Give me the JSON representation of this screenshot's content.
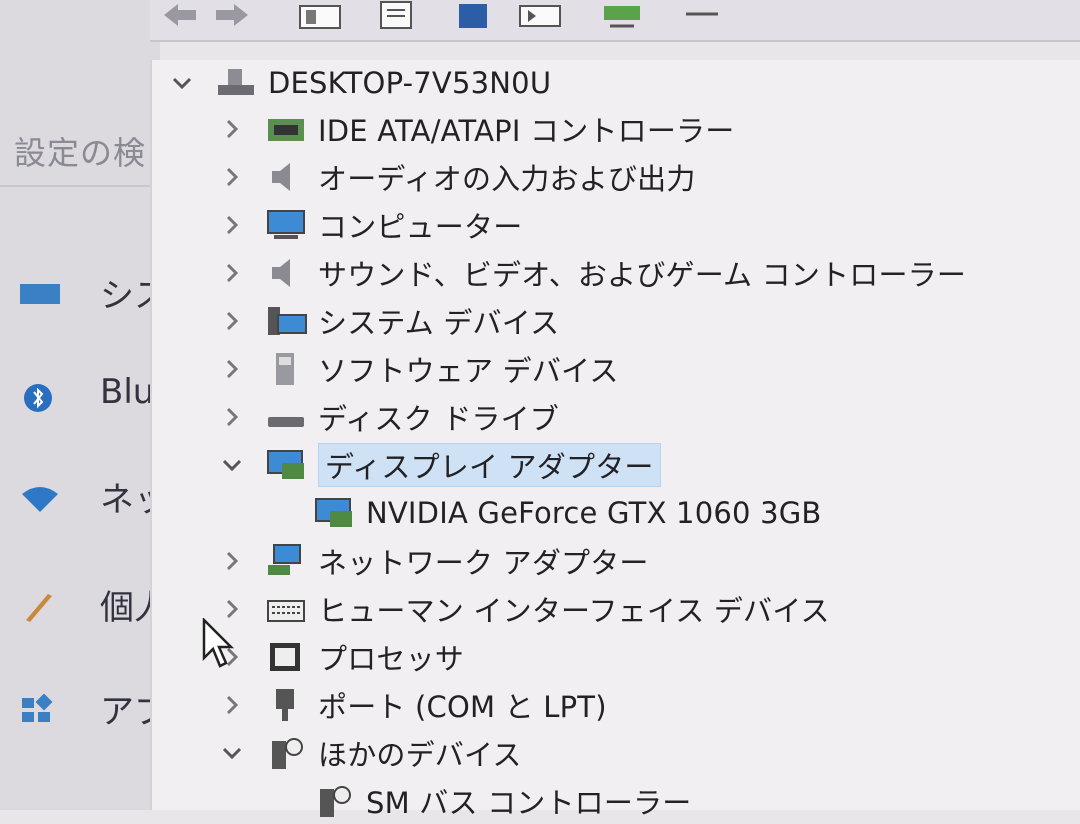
{
  "settings": {
    "search_label": "設定の検",
    "items": [
      {
        "label": "シス",
        "icon": "display-icon"
      },
      {
        "label": "Blu",
        "icon": "bluetooth-icon"
      },
      {
        "label": "ネッ",
        "icon": "wifi-icon"
      },
      {
        "label": "個人",
        "icon": "brush-icon"
      },
      {
        "label": "アプ",
        "icon": "apps-icon"
      }
    ]
  },
  "toolbar": {
    "buttons": [
      "back-icon",
      "forward-icon",
      "properties-icon",
      "update-driver-icon",
      "help-icon",
      "scan-icon",
      "monitor-icon",
      "remove-icon"
    ]
  },
  "tree": {
    "root": "DESKTOP-7V53N0U",
    "categories": [
      {
        "label": "IDE ATA/ATAPI コントローラー",
        "icon": "ide-controller-icon",
        "expanded": false
      },
      {
        "label": "オーディオの入力および出力",
        "icon": "speaker-icon",
        "expanded": false
      },
      {
        "label": "コンピューター",
        "icon": "computer-icon",
        "expanded": false
      },
      {
        "label": "サウンド、ビデオ、およびゲーム コントローラー",
        "icon": "speaker-icon",
        "expanded": false
      },
      {
        "label": "システム デバイス",
        "icon": "system-device-icon",
        "expanded": false
      },
      {
        "label": "ソフトウェア デバイス",
        "icon": "software-device-icon",
        "expanded": false
      },
      {
        "label": "ディスク ドライブ",
        "icon": "disk-drive-icon",
        "expanded": false
      },
      {
        "label": "ディスプレイ アダプター",
        "icon": "display-adapter-icon",
        "expanded": true,
        "selected": true
      },
      {
        "label": "NVIDIA GeForce GTX 1060 3GB",
        "icon": "display-adapter-icon",
        "child": true
      },
      {
        "label": "ネットワーク アダプター",
        "icon": "network-adapter-icon",
        "expanded": false
      },
      {
        "label": "ヒューマン インターフェイス デバイス",
        "icon": "hid-icon",
        "expanded": false
      },
      {
        "label": "プロセッサ",
        "icon": "processor-icon",
        "expanded": false
      },
      {
        "label": "ポート (COM と LPT)",
        "icon": "port-icon",
        "expanded": false
      },
      {
        "label": "ほかのデバイス",
        "icon": "unknown-device-icon",
        "expanded": true
      },
      {
        "label": "SM バス コントローラー",
        "icon": "unknown-device-icon",
        "child": true
      }
    ]
  }
}
